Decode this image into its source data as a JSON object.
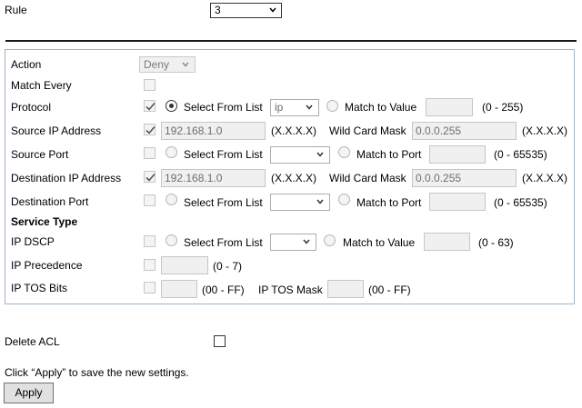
{
  "rule": {
    "label": "Rule",
    "value": "3"
  },
  "rows": {
    "action": {
      "label": "Action",
      "value": "Deny"
    },
    "match_every": {
      "label": "Match Every"
    },
    "protocol": {
      "label": "Protocol",
      "select_from_list": "Select From List",
      "list_value": "ip",
      "match_to_value": "Match to Value",
      "range": "(0 - 255)"
    },
    "source_ip": {
      "label": "Source IP Address",
      "ip": "192.168.1.0",
      "format": "(X.X.X.X)",
      "wild_card_label": "Wild Card Mask",
      "wild_card": "0.0.0.255",
      "format2": "(X.X.X.X)"
    },
    "source_port": {
      "label": "Source Port",
      "select_from_list": "Select From List",
      "match_to_port": "Match to Port",
      "range": "(0 - 65535)"
    },
    "dest_ip": {
      "label": "Destination IP Address",
      "ip": "192.168.1.0",
      "format": "(X.X.X.X)",
      "wild_card_label": "Wild Card Mask",
      "wild_card": "0.0.0.255",
      "format2": "(X.X.X.X)"
    },
    "dest_port": {
      "label": "Destination Port",
      "select_from_list": "Select From List",
      "match_to_port": "Match to Port",
      "range": "(0 - 65535)"
    },
    "service_type": {
      "label": "Service Type"
    },
    "ip_dscp": {
      "label": "IP DSCP",
      "select_from_list": "Select From List",
      "match_to_value": "Match to Value",
      "range": "(0 - 63)"
    },
    "ip_precedence": {
      "label": "IP Precedence",
      "range": "(0 - 7)"
    },
    "ip_tos": {
      "label": "IP TOS Bits",
      "range": "(00 - FF)",
      "mask_label": "IP TOS Mask",
      "mask_range": "(00 - FF)"
    }
  },
  "delete_acl": {
    "label": "Delete ACL"
  },
  "footer": {
    "note": "Click “Apply” to save the new settings.",
    "apply": "Apply"
  }
}
